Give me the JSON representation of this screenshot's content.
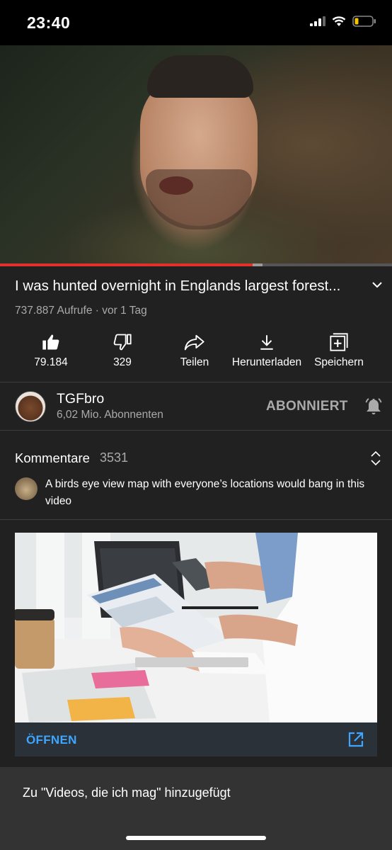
{
  "status_bar": {
    "time": "23:40",
    "battery_level": 0.18
  },
  "video": {
    "title": "I was hunted overnight in Englands largest forest...",
    "views": "737.887 Aufrufe",
    "age": "vor 1 Tag",
    "meta_separator": " · ",
    "progress": 0.645,
    "buffered": 0.67
  },
  "actions": {
    "like": "79.184",
    "dislike": "329",
    "share": "Teilen",
    "download": "Herunterladen",
    "save": "Speichern"
  },
  "channel": {
    "name": "TGFbro",
    "subscribers": "6,02 Mio. Abonnenten",
    "subscribed_label": "ABONNIERT"
  },
  "comments": {
    "label": "Kommentare",
    "count": "3531",
    "top_comment": "A birds eye view map with everyone’s locations would bang in this video"
  },
  "ad": {
    "cta_label": "ÖFFNEN"
  },
  "toast": {
    "message": "Zu \"Videos, die ich mag\" hinzugefügt"
  },
  "colors": {
    "accent_red": "#e3302a",
    "link_blue": "#3ea6ff",
    "background": "#212121"
  }
}
